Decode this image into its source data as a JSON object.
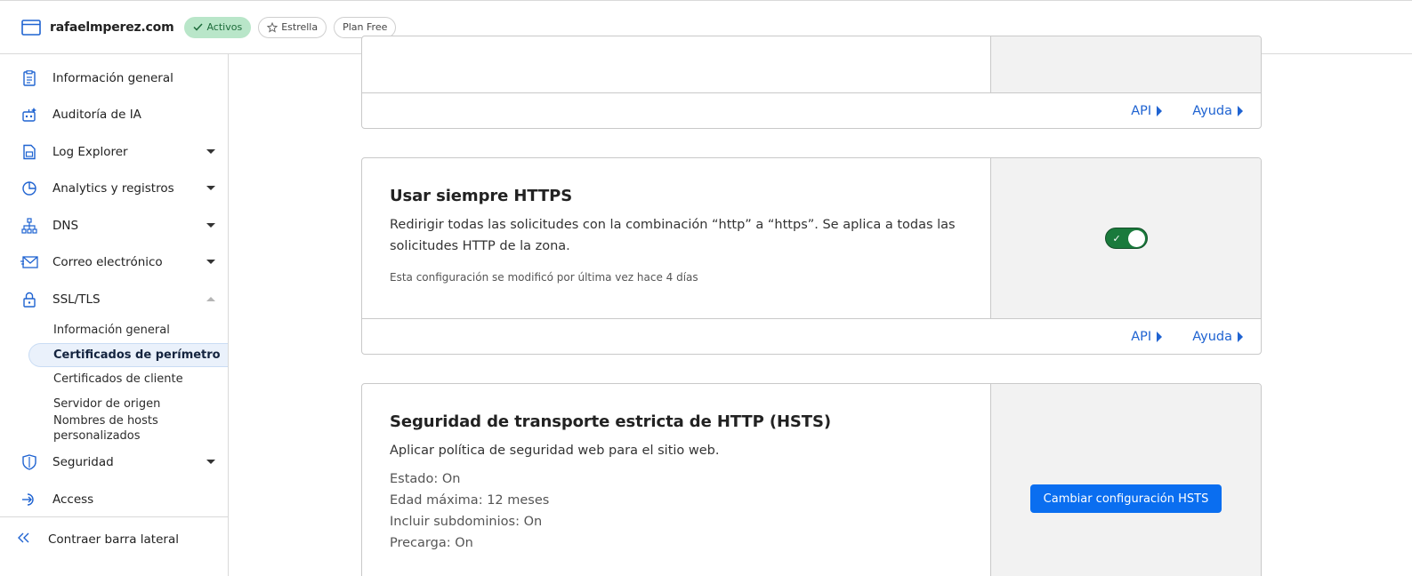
{
  "header": {
    "site_name": "rafaelmperez.com",
    "badges": {
      "active": "Activos",
      "star": "Estrella",
      "plan": "Plan Free"
    }
  },
  "sidebar": {
    "items": [
      {
        "label": "Información general",
        "icon": "document-icon"
      },
      {
        "label": "Auditoría de IA",
        "icon": "robot-icon"
      },
      {
        "label": "Log Explorer",
        "icon": "log-icon"
      },
      {
        "label": "Analytics y registros",
        "icon": "pie-chart-icon"
      },
      {
        "label": "DNS",
        "icon": "network-icon"
      },
      {
        "label": "Correo electrónico",
        "icon": "mail-icon"
      },
      {
        "label": "SSL/TLS",
        "icon": "lock-icon"
      },
      {
        "label": "Seguridad",
        "icon": "shield-icon"
      },
      {
        "label": "Access",
        "icon": "access-icon"
      }
    ],
    "ssl_sub": [
      "Información general",
      "Certificados de perímetro",
      "Certificados de cliente",
      "Servidor de origen",
      "Nombres de hosts personalizados"
    ],
    "collapse_label": "Contraer barra lateral"
  },
  "cards": {
    "top": {
      "api": "API",
      "help": "Ayuda"
    },
    "https": {
      "title": "Usar siempre HTTPS",
      "description": "Redirigir todas las solicitudes con la combinación “http” a “https”. Se aplica a todas las solicitudes HTTP de la zona.",
      "modified": "Esta configuración se modificó por última vez hace 4 días",
      "toggle_state": "on",
      "api": "API",
      "help": "Ayuda"
    },
    "hsts": {
      "title": "Seguridad de transporte estricta de HTTP (HSTS)",
      "description": "Aplicar política de seguridad web para el sitio web.",
      "status_lines": [
        "Estado: On",
        "Edad máxima: 12 meses",
        "Incluir subdominios: On",
        "Precarga: On"
      ],
      "button": "Cambiar configuración HSTS"
    }
  },
  "colors": {
    "accent": "#1f63d1",
    "button": "#0a6ef0",
    "toggle_on": "#1a7a3c",
    "badge_active": "#b9e6c9"
  }
}
